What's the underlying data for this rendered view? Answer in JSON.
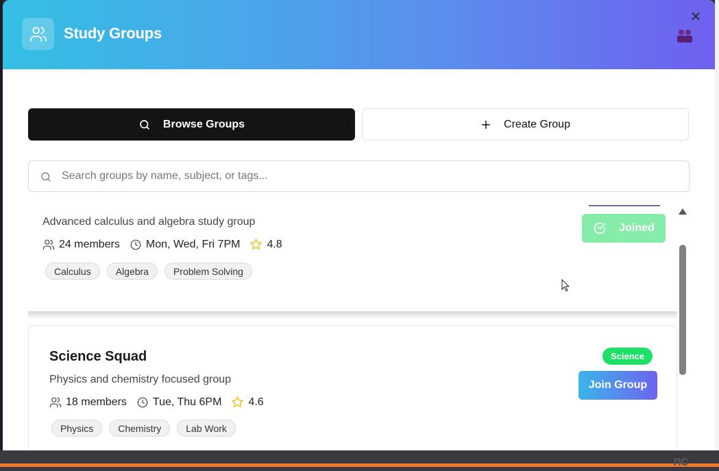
{
  "header": {
    "title": "Study Groups",
    "icon": "users-icon",
    "close_symbol": "✕"
  },
  "tabs": {
    "browse_label": "Browse Groups",
    "create_label": "Create Group"
  },
  "search": {
    "placeholder": "Search groups by name, subject, or tags...",
    "value": ""
  },
  "groups": [
    {
      "title": "",
      "description": "Advanced calculus and algebra study group",
      "members": "24 members",
      "schedule": "Mon, Wed, Fri 7PM",
      "rating": "4.8",
      "tags": [
        "Calculus",
        "Algebra",
        "Problem Solving"
      ],
      "action_label": "Joined",
      "action_state": "joined"
    },
    {
      "title": "Science Squad",
      "subject_badge": "Science",
      "description": "Physics and chemistry focused group",
      "members": "18 members",
      "schedule": "Tue, Thu 6PM",
      "rating": "4.6",
      "tags": [
        "Physics",
        "Chemistry",
        "Lab Work"
      ],
      "action_label": "Join Group",
      "action_state": "available"
    }
  ],
  "colors": {
    "header_gradient_start": "#34bfe3",
    "header_gradient_end": "#6f60ef",
    "joined_green": "#86ecaa",
    "science_badge": "#1ee067",
    "star_yellow": "#e8c21a"
  },
  "corner_logo": "nc"
}
